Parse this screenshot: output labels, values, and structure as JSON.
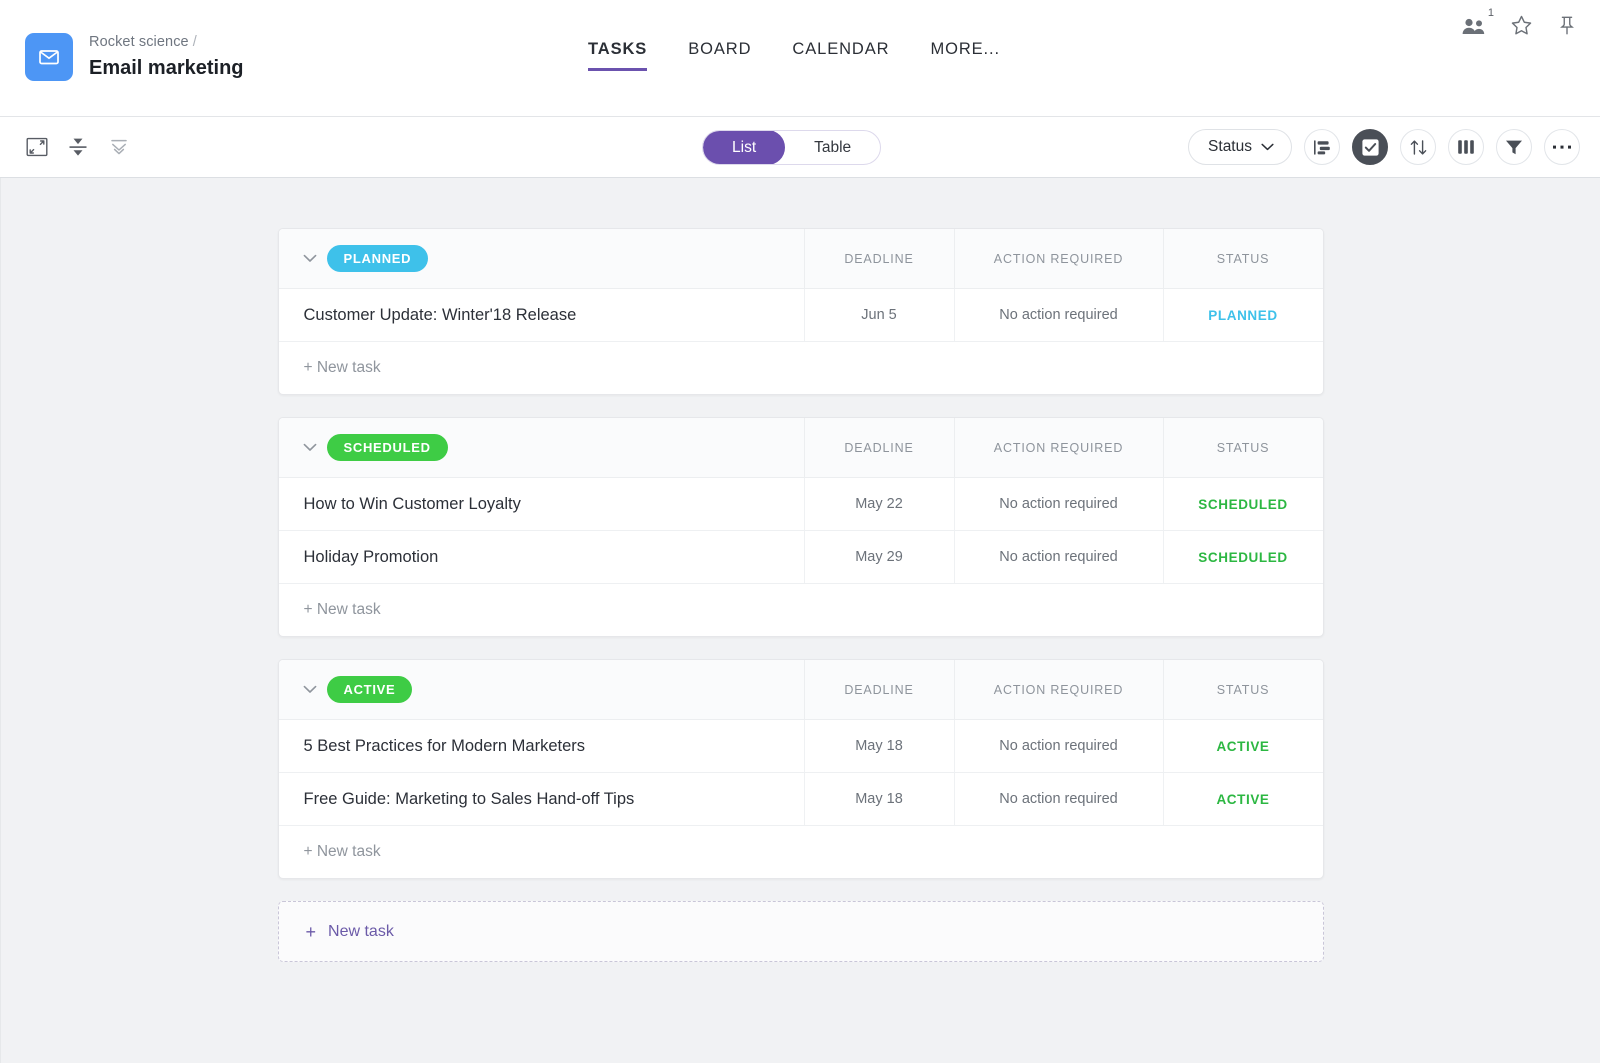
{
  "header": {
    "app_icon": "envelope-icon",
    "breadcrumb_parent": "Rocket science",
    "breadcrumb_separator": "/",
    "title": "Email marketing",
    "nav_tabs": [
      {
        "label": "TASKS",
        "active": true
      },
      {
        "label": "BOARD",
        "active": false
      },
      {
        "label": "CALENDAR",
        "active": false
      },
      {
        "label": "MORE...",
        "active": false
      }
    ],
    "actions": [
      {
        "icon": "people-icon",
        "badge": "1"
      },
      {
        "icon": "star-icon",
        "badge": ""
      },
      {
        "icon": "pin-icon",
        "badge": ""
      }
    ]
  },
  "toolbar": {
    "left_icons": [
      {
        "icon": "expand-fullscreen-icon"
      },
      {
        "icon": "collapse-vertical-icon"
      },
      {
        "icon": "collapse-all-icon"
      }
    ],
    "view_toggle": {
      "options": [
        "List",
        "Table"
      ],
      "selected": "List"
    },
    "status_filter_label": "Status",
    "right_icons": [
      {
        "icon": "gantt-icon"
      },
      {
        "icon": "checkbox-checked-icon"
      },
      {
        "icon": "sort-icon"
      },
      {
        "icon": "columns-icon"
      },
      {
        "icon": "filter-icon"
      },
      {
        "icon": "more-horizontal-icon"
      }
    ]
  },
  "columns": {
    "name": "",
    "deadline": "DEADLINE",
    "action": "ACTION REQUIRED",
    "status": "STATUS"
  },
  "colors": {
    "planned": "#3ec1ea",
    "scheduled": "#3ecc45",
    "active": "#3ecc45",
    "accent_purple": "#6b4fae",
    "brand_blue": "#4d96f5"
  },
  "groups": [
    {
      "name": "PLANNED",
      "badge_color": "#3ec1ea",
      "status_color": "#3ec1ea",
      "new_task_label": "+ New task",
      "tasks": [
        {
          "title": "Customer Update: Winter'18 Release",
          "deadline": "Jun 5",
          "action": "No action required",
          "status": "PLANNED"
        }
      ]
    },
    {
      "name": "SCHEDULED",
      "badge_color": "#3ecc45",
      "status_color": "#2cb742",
      "new_task_label": "+ New task",
      "tasks": [
        {
          "title": "How to Win Customer Loyalty",
          "deadline": "May 22",
          "action": "No action required",
          "status": "SCHEDULED"
        },
        {
          "title": "Holiday Promotion",
          "deadline": "May 29",
          "action": "No action required",
          "status": "SCHEDULED"
        }
      ]
    },
    {
      "name": "ACTIVE",
      "badge_color": "#3ecc45",
      "status_color": "#2cb742",
      "new_task_label": "+ New task",
      "tasks": [
        {
          "title": "5 Best Practices for Modern Marketers",
          "deadline": "May 18",
          "action": "No action required",
          "status": "ACTIVE"
        },
        {
          "title": "Free Guide: Marketing to Sales Hand-off Tips",
          "deadline": "May 18",
          "action": "No action required",
          "status": "ACTIVE"
        }
      ]
    }
  ],
  "footer": {
    "new_task_plus": "+",
    "new_task_label": "New task"
  }
}
